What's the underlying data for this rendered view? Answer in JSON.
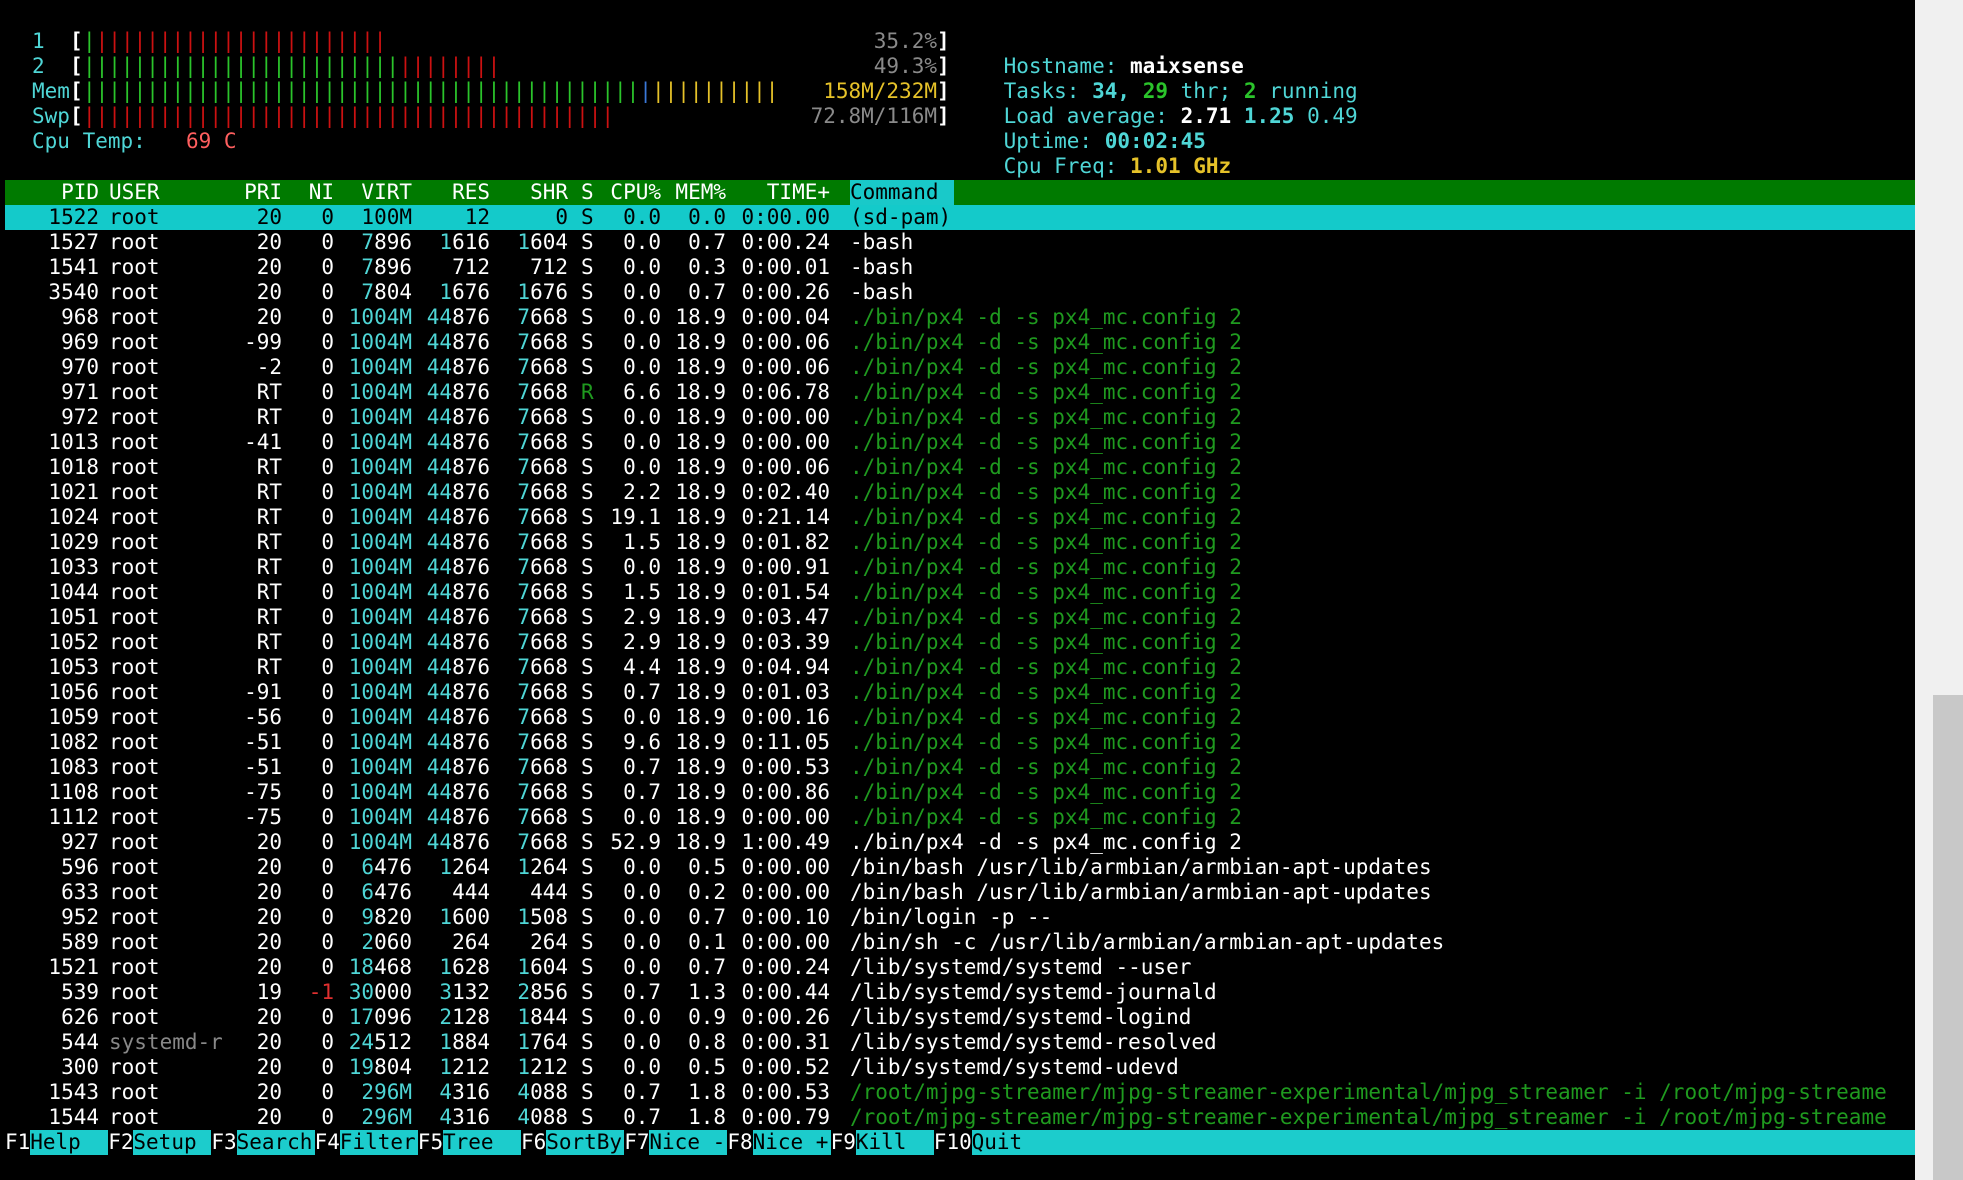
{
  "meters": {
    "cpu1": {
      "label": "1",
      "value": "35.2%",
      "fraction": 0.352
    },
    "cpu2": {
      "label": "2",
      "value": "49.3%",
      "fraction": 0.493
    },
    "mem": {
      "label": "Mem",
      "value": "158M/232M"
    },
    "swp": {
      "label": "Swp",
      "value": "72.8M/116M"
    },
    "temp": {
      "label": "Cpu Temp:",
      "value": "69 C"
    }
  },
  "info": {
    "hostname_label": "Hostname:",
    "hostname": "maixsense",
    "tasks_label": "Tasks:",
    "tasks": "34,",
    "thr": "29",
    "thr_label": "thr;",
    "running": "2",
    "running_label": "running",
    "load_label": "Load average:",
    "load1": "2.71",
    "load5": "1.25",
    "load15": "0.49",
    "uptime_label": "Uptime:",
    "uptime": "00:02:45",
    "freq_label": "Cpu Freq:",
    "freq": "1.01 GHz"
  },
  "columns": [
    "PID",
    "USER",
    "PRI",
    "NI",
    "VIRT",
    "RES",
    "SHR",
    "S",
    "CPU%",
    "MEM%",
    "TIME+",
    "Command"
  ],
  "processes": [
    {
      "pid": "1522",
      "user": "root",
      "pri": "20",
      "ni": "0",
      "virt": "100M",
      "res": "12",
      "shr": "0",
      "s": "S",
      "cpu": "0.0",
      "mem": "0.0",
      "time": "0:00.00",
      "cmd": "(sd-pam)",
      "kind": "sel"
    },
    {
      "pid": "1527",
      "user": "root",
      "pri": "20",
      "ni": "0",
      "virt": "7896",
      "res": "1616",
      "shr": "1604",
      "s": "S",
      "cpu": "0.0",
      "mem": "0.7",
      "time": "0:00.24",
      "cmd": "-bash",
      "kind": "proc"
    },
    {
      "pid": "1541",
      "user": "root",
      "pri": "20",
      "ni": "0",
      "virt": "7896",
      "res": "712",
      "shr": "712",
      "s": "S",
      "cpu": "0.0",
      "mem": "0.3",
      "time": "0:00.01",
      "cmd": "-bash",
      "kind": "proc"
    },
    {
      "pid": "3540",
      "user": "root",
      "pri": "20",
      "ni": "0",
      "virt": "7804",
      "res": "1676",
      "shr": "1676",
      "s": "S",
      "cpu": "0.0",
      "mem": "0.7",
      "time": "0:00.26",
      "cmd": "-bash",
      "kind": "proc"
    },
    {
      "pid": "968",
      "user": "root",
      "pri": "20",
      "ni": "0",
      "virt": "1004M",
      "res": "44876",
      "shr": "7668",
      "s": "S",
      "cpu": "0.0",
      "mem": "18.9",
      "time": "0:00.04",
      "cmd": "./bin/px4 -d -s px4_mc.config 2",
      "kind": "thread"
    },
    {
      "pid": "969",
      "user": "root",
      "pri": "-99",
      "ni": "0",
      "virt": "1004M",
      "res": "44876",
      "shr": "7668",
      "s": "S",
      "cpu": "0.0",
      "mem": "18.9",
      "time": "0:00.06",
      "cmd": "./bin/px4 -d -s px4_mc.config 2",
      "kind": "thread"
    },
    {
      "pid": "970",
      "user": "root",
      "pri": "-2",
      "ni": "0",
      "virt": "1004M",
      "res": "44876",
      "shr": "7668",
      "s": "S",
      "cpu": "0.0",
      "mem": "18.9",
      "time": "0:00.06",
      "cmd": "./bin/px4 -d -s px4_mc.config 2",
      "kind": "thread"
    },
    {
      "pid": "971",
      "user": "root",
      "pri": "RT",
      "ni": "0",
      "virt": "1004M",
      "res": "44876",
      "shr": "7668",
      "s": "R",
      "cpu": "6.6",
      "mem": "18.9",
      "time": "0:06.78",
      "cmd": "./bin/px4 -d -s px4_mc.config 2",
      "kind": "thread"
    },
    {
      "pid": "972",
      "user": "root",
      "pri": "RT",
      "ni": "0",
      "virt": "1004M",
      "res": "44876",
      "shr": "7668",
      "s": "S",
      "cpu": "0.0",
      "mem": "18.9",
      "time": "0:00.00",
      "cmd": "./bin/px4 -d -s px4_mc.config 2",
      "kind": "thread"
    },
    {
      "pid": "1013",
      "user": "root",
      "pri": "-41",
      "ni": "0",
      "virt": "1004M",
      "res": "44876",
      "shr": "7668",
      "s": "S",
      "cpu": "0.0",
      "mem": "18.9",
      "time": "0:00.00",
      "cmd": "./bin/px4 -d -s px4_mc.config 2",
      "kind": "thread"
    },
    {
      "pid": "1018",
      "user": "root",
      "pri": "RT",
      "ni": "0",
      "virt": "1004M",
      "res": "44876",
      "shr": "7668",
      "s": "S",
      "cpu": "0.0",
      "mem": "18.9",
      "time": "0:00.06",
      "cmd": "./bin/px4 -d -s px4_mc.config 2",
      "kind": "thread"
    },
    {
      "pid": "1021",
      "user": "root",
      "pri": "RT",
      "ni": "0",
      "virt": "1004M",
      "res": "44876",
      "shr": "7668",
      "s": "S",
      "cpu": "2.2",
      "mem": "18.9",
      "time": "0:02.40",
      "cmd": "./bin/px4 -d -s px4_mc.config 2",
      "kind": "thread"
    },
    {
      "pid": "1024",
      "user": "root",
      "pri": "RT",
      "ni": "0",
      "virt": "1004M",
      "res": "44876",
      "shr": "7668",
      "s": "S",
      "cpu": "19.1",
      "mem": "18.9",
      "time": "0:21.14",
      "cmd": "./bin/px4 -d -s px4_mc.config 2",
      "kind": "thread"
    },
    {
      "pid": "1029",
      "user": "root",
      "pri": "RT",
      "ni": "0",
      "virt": "1004M",
      "res": "44876",
      "shr": "7668",
      "s": "S",
      "cpu": "1.5",
      "mem": "18.9",
      "time": "0:01.82",
      "cmd": "./bin/px4 -d -s px4_mc.config 2",
      "kind": "thread"
    },
    {
      "pid": "1033",
      "user": "root",
      "pri": "RT",
      "ni": "0",
      "virt": "1004M",
      "res": "44876",
      "shr": "7668",
      "s": "S",
      "cpu": "0.0",
      "mem": "18.9",
      "time": "0:00.91",
      "cmd": "./bin/px4 -d -s px4_mc.config 2",
      "kind": "thread"
    },
    {
      "pid": "1044",
      "user": "root",
      "pri": "RT",
      "ni": "0",
      "virt": "1004M",
      "res": "44876",
      "shr": "7668",
      "s": "S",
      "cpu": "1.5",
      "mem": "18.9",
      "time": "0:01.54",
      "cmd": "./bin/px4 -d -s px4_mc.config 2",
      "kind": "thread"
    },
    {
      "pid": "1051",
      "user": "root",
      "pri": "RT",
      "ni": "0",
      "virt": "1004M",
      "res": "44876",
      "shr": "7668",
      "s": "S",
      "cpu": "2.9",
      "mem": "18.9",
      "time": "0:03.47",
      "cmd": "./bin/px4 -d -s px4_mc.config 2",
      "kind": "thread"
    },
    {
      "pid": "1052",
      "user": "root",
      "pri": "RT",
      "ni": "0",
      "virt": "1004M",
      "res": "44876",
      "shr": "7668",
      "s": "S",
      "cpu": "2.9",
      "mem": "18.9",
      "time": "0:03.39",
      "cmd": "./bin/px4 -d -s px4_mc.config 2",
      "kind": "thread"
    },
    {
      "pid": "1053",
      "user": "root",
      "pri": "RT",
      "ni": "0",
      "virt": "1004M",
      "res": "44876",
      "shr": "7668",
      "s": "S",
      "cpu": "4.4",
      "mem": "18.9",
      "time": "0:04.94",
      "cmd": "./bin/px4 -d -s px4_mc.config 2",
      "kind": "thread"
    },
    {
      "pid": "1056",
      "user": "root",
      "pri": "-91",
      "ni": "0",
      "virt": "1004M",
      "res": "44876",
      "shr": "7668",
      "s": "S",
      "cpu": "0.7",
      "mem": "18.9",
      "time": "0:01.03",
      "cmd": "./bin/px4 -d -s px4_mc.config 2",
      "kind": "thread"
    },
    {
      "pid": "1059",
      "user": "root",
      "pri": "-56",
      "ni": "0",
      "virt": "1004M",
      "res": "44876",
      "shr": "7668",
      "s": "S",
      "cpu": "0.0",
      "mem": "18.9",
      "time": "0:00.16",
      "cmd": "./bin/px4 -d -s px4_mc.config 2",
      "kind": "thread"
    },
    {
      "pid": "1082",
      "user": "root",
      "pri": "-51",
      "ni": "0",
      "virt": "1004M",
      "res": "44876",
      "shr": "7668",
      "s": "S",
      "cpu": "9.6",
      "mem": "18.9",
      "time": "0:11.05",
      "cmd": "./bin/px4 -d -s px4_mc.config 2",
      "kind": "thread"
    },
    {
      "pid": "1083",
      "user": "root",
      "pri": "-51",
      "ni": "0",
      "virt": "1004M",
      "res": "44876",
      "shr": "7668",
      "s": "S",
      "cpu": "0.7",
      "mem": "18.9",
      "time": "0:00.53",
      "cmd": "./bin/px4 -d -s px4_mc.config 2",
      "kind": "thread"
    },
    {
      "pid": "1108",
      "user": "root",
      "pri": "-75",
      "ni": "0",
      "virt": "1004M",
      "res": "44876",
      "shr": "7668",
      "s": "S",
      "cpu": "0.7",
      "mem": "18.9",
      "time": "0:00.86",
      "cmd": "./bin/px4 -d -s px4_mc.config 2",
      "kind": "thread"
    },
    {
      "pid": "1112",
      "user": "root",
      "pri": "-75",
      "ni": "0",
      "virt": "1004M",
      "res": "44876",
      "shr": "7668",
      "s": "S",
      "cpu": "0.0",
      "mem": "18.9",
      "time": "0:00.00",
      "cmd": "./bin/px4 -d -s px4_mc.config 2",
      "kind": "thread"
    },
    {
      "pid": "927",
      "user": "root",
      "pri": "20",
      "ni": "0",
      "virt": "1004M",
      "res": "44876",
      "shr": "7668",
      "s": "S",
      "cpu": "52.9",
      "mem": "18.9",
      "time": "1:00.49",
      "cmd": "./bin/px4 -d -s px4_mc.config 2",
      "kind": "proc"
    },
    {
      "pid": "596",
      "user": "root",
      "pri": "20",
      "ni": "0",
      "virt": "6476",
      "res": "1264",
      "shr": "1264",
      "s": "S",
      "cpu": "0.0",
      "mem": "0.5",
      "time": "0:00.00",
      "cmd": "/bin/bash /usr/lib/armbian/armbian-apt-updates",
      "kind": "proc"
    },
    {
      "pid": "633",
      "user": "root",
      "pri": "20",
      "ni": "0",
      "virt": "6476",
      "res": "444",
      "shr": "444",
      "s": "S",
      "cpu": "0.0",
      "mem": "0.2",
      "time": "0:00.00",
      "cmd": "/bin/bash /usr/lib/armbian/armbian-apt-updates",
      "kind": "proc"
    },
    {
      "pid": "952",
      "user": "root",
      "pri": "20",
      "ni": "0",
      "virt": "9820",
      "res": "1600",
      "shr": "1508",
      "s": "S",
      "cpu": "0.0",
      "mem": "0.7",
      "time": "0:00.10",
      "cmd": "/bin/login -p --",
      "kind": "proc"
    },
    {
      "pid": "589",
      "user": "root",
      "pri": "20",
      "ni": "0",
      "virt": "2060",
      "res": "264",
      "shr": "264",
      "s": "S",
      "cpu": "0.0",
      "mem": "0.1",
      "time": "0:00.00",
      "cmd": "/bin/sh -c /usr/lib/armbian/armbian-apt-updates",
      "kind": "proc"
    },
    {
      "pid": "1521",
      "user": "root",
      "pri": "20",
      "ni": "0",
      "virt": "18468",
      "res": "1628",
      "shr": "1604",
      "s": "S",
      "cpu": "0.0",
      "mem": "0.7",
      "time": "0:00.24",
      "cmd": "/lib/systemd/systemd --user",
      "kind": "proc"
    },
    {
      "pid": "539",
      "user": "root",
      "pri": "19",
      "ni": "-1",
      "virt": "30000",
      "res": "3132",
      "shr": "2856",
      "s": "S",
      "cpu": "0.7",
      "mem": "1.3",
      "time": "0:00.44",
      "cmd": "/lib/systemd/systemd-journald",
      "kind": "proc"
    },
    {
      "pid": "626",
      "user": "root",
      "pri": "20",
      "ni": "0",
      "virt": "17096",
      "res": "2128",
      "shr": "1844",
      "s": "S",
      "cpu": "0.0",
      "mem": "0.9",
      "time": "0:00.26",
      "cmd": "/lib/systemd/systemd-logind",
      "kind": "proc"
    },
    {
      "pid": "544",
      "user": "systemd-r",
      "pri": "20",
      "ni": "0",
      "virt": "24512",
      "res": "1884",
      "shr": "1764",
      "s": "S",
      "cpu": "0.0",
      "mem": "0.8",
      "time": "0:00.31",
      "cmd": "/lib/systemd/systemd-resolved",
      "kind": "proc"
    },
    {
      "pid": "300",
      "user": "root",
      "pri": "20",
      "ni": "0",
      "virt": "19804",
      "res": "1212",
      "shr": "1212",
      "s": "S",
      "cpu": "0.0",
      "mem": "0.5",
      "time": "0:00.52",
      "cmd": "/lib/systemd/systemd-udevd",
      "kind": "proc"
    },
    {
      "pid": "1543",
      "user": "root",
      "pri": "20",
      "ni": "0",
      "virt": "296M",
      "res": "4316",
      "shr": "4088",
      "s": "S",
      "cpu": "0.7",
      "mem": "1.8",
      "time": "0:00.53",
      "cmd": "/root/mjpg-streamer/mjpg-streamer-experimental/mjpg_streamer -i /root/mjpg-streame",
      "kind": "thread"
    },
    {
      "pid": "1544",
      "user": "root",
      "pri": "20",
      "ni": "0",
      "virt": "296M",
      "res": "4316",
      "shr": "4088",
      "s": "S",
      "cpu": "0.7",
      "mem": "1.8",
      "time": "0:00.79",
      "cmd": "/root/mjpg-streamer/mjpg-streamer-experimental/mjpg_streamer -i /root/mjpg-streame",
      "kind": "thread"
    }
  ],
  "fkeys": [
    {
      "key": "F1",
      "label": "Help"
    },
    {
      "key": "F2",
      "label": "Setup"
    },
    {
      "key": "F3",
      "label": "Search"
    },
    {
      "key": "F4",
      "label": "Filter"
    },
    {
      "key": "F5",
      "label": "Tree"
    },
    {
      "key": "F6",
      "label": "SortBy"
    },
    {
      "key": "F7",
      "label": "Nice -"
    },
    {
      "key": "F8",
      "label": "Nice +"
    },
    {
      "key": "F9",
      "label": "Kill"
    },
    {
      "key": "F10",
      "label": "Quit"
    }
  ],
  "colors": {
    "cyan": "#4fd6d6",
    "green": "#2bc42b",
    "red": "#cc1111",
    "yellow": "#e6c229",
    "blue": "#3a78d8",
    "header_bg": "#007a00",
    "select_bg": "#14caca",
    "thread_green": "#1f9a1f",
    "gray": "#888888"
  }
}
